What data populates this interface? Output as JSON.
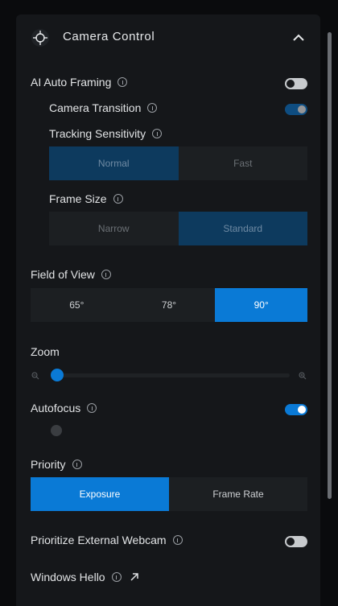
{
  "header": {
    "title": "Camera Control"
  },
  "ai_auto_framing": {
    "label": "AI Auto Framing",
    "enabled": false,
    "camera_transition": {
      "label": "Camera Transition",
      "enabled": true
    },
    "tracking_sensitivity": {
      "label": "Tracking Sensitivity",
      "options": [
        "Normal",
        "Fast"
      ],
      "selected": "Normal"
    },
    "frame_size": {
      "label": "Frame Size",
      "options": [
        "Narrow",
        "Standard"
      ],
      "selected": "Standard"
    }
  },
  "field_of_view": {
    "label": "Field of View",
    "options": [
      "65°",
      "78°",
      "90°"
    ],
    "selected": "90°"
  },
  "zoom": {
    "label": "Zoom",
    "value_fraction": 0.0
  },
  "autofocus": {
    "label": "Autofocus",
    "enabled": true
  },
  "priority": {
    "label": "Priority",
    "options": [
      "Exposure",
      "Frame Rate"
    ],
    "selected": "Exposure"
  },
  "prioritize_external_webcam": {
    "label": "Prioritize External Webcam",
    "enabled": false
  },
  "windows_hello": {
    "label": "Windows Hello"
  },
  "colors": {
    "accent": "#0a7ad6",
    "panel": "#15171a",
    "background": "#0a0b0d"
  }
}
